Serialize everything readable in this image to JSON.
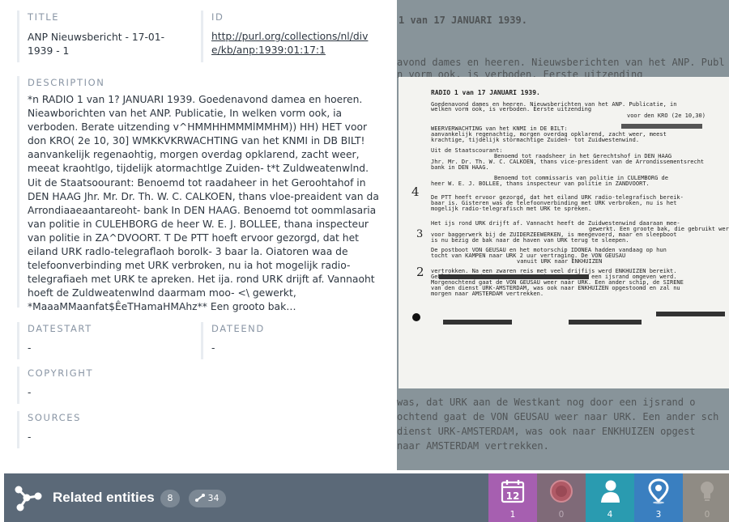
{
  "metadata": {
    "title_label": "TITLE",
    "title_value": "ANP Nieuwsbericht - 17-01-1939 - 1",
    "id_label": "ID",
    "id_value": "http://purl.org/collections/nl/dive/kb/anp:1939:01:17:1",
    "description_label": "DESCRIPTION",
    "description_value": "*n RADIO 1 van 1? JANUARI 1939. Goedenavond damea en hoeren. Nieawborichten van het ANP. Publicatie, In welken vorm ook, ia verboden. Berate uitzending v^HMMHHMMMlMMHM)) HH) HET voor don KRO( 2e 10, 30] WMKKVKRWACHTING van het KNMI in DB BILT! aanvankelijk regenaohtig, morgen overdag opklarend, zacht weer, meeat kraohtlgo, tijdelijk atormachtlge Zuiden- t*t Zuldweatenwlnd. Uit de Staatsoourant: Benoemd tot raadaheer in het Geroohtahof in DEN HAAG Jhr. Mr. Dr. Th. W. C. CALKOEN, thans vloe-preaident van da Arrondiaaeaantareoht- bank In DEN HAAG. Benoemd tot oommlasaria van politie in CULEHBORG de heer W. E. J. BOLLEE, thana inspecteur van politie in ZA^DVOORT. T De PTT hoeft ervoor gezorgd, dat het eiland URK radlo-telegraflaoh borolk- 3 baar la. Oiatoren waa de telefoonverbinding met URK verbroken, nu ia hot mogelijk radio-telegrafiaeh met URK te apreken. Het ija. rond URK drijft af. Vannaoht hoeft de Zuldweatenwlnd daarmam moo- <\\ gewerkt, *MaaaMMaanfat$ÊeTHamaHMAhz** Een grooto bak…",
    "datestart_label": "DATESTART",
    "datestart_value": "-",
    "dateend_label": "DATEEND",
    "dateend_value": "-",
    "copyright_label": "COPYRIGHT",
    "copyright_value": "-",
    "sources_label": "SOURCES",
    "sources_value": "-"
  },
  "scan": {
    "top_line": "1 van 17 JANUARI 1939.",
    "header_line": "RADIO 1 van 17 JANUARI 1939.",
    "lines": [
      "Goedenavond dames en heeren. Nieuwsberichten van het ANP. Publicatie, in",
      "welken vorm ook, is verboden. Eerste uitzending",
      "voor den KRO (2e 10,30)",
      "WEERVERWACHTING van het KNMI in DE BILT:",
      "aanvankelijk regenachtig, morgen overdag opklarend, zacht weer, meest",
      "krachtige, tijdelijk stormachtige Zuiden- tot Zuidwestenwind.",
      "Uit de Staatscourant:",
      "Benoemd tot raadsheer in het Gerechtshof in DEN HAAG",
      "Jhr. Mr. Dr. Th. W. C. CALKOEN, thans vice-president van de Arrondissementsrecht",
      "bank in DEN HAAG.",
      "Benoemd tot commissaris van politie in CULEMBORG de",
      "heer W. E. J. BOLLEE, thans inspecteur van politie in ZANDVOORT.",
      "De PTT heeft ervoor gezorgd, dat het eiland URK radio-telegrafisch bereik-",
      "baar is. Gisteren was de telefoonverbinding met URK verbroken, nu is het",
      "mogelijk radio-telegrafisch met URK te spreken.",
      "Het ijs rond URK drijft af. Vannacht heeft de Zuidwestenwind daaraan mee-",
      "gewerkt. Een groote bak, die gebruikt werd",
      "voor baggerwerk bij de ZUIDERZEEWERKEN, is meegevoerd, maar en sleepboot",
      "is nu bezig de bak naar de haven van URK terug te sleepen.",
      "De postboot VON GEUSAU en het motorschip IDONEA hadden vandaag op hun",
      "tocht van KAMPEN naar URK 2 uur vertraging. De VON GEUSAU",
      "vanuit URK naar ENKHUIZEN",
      "vertrokken. Na een zwaren reis met veel drijfijs werd ENKHUIZEN bereikt.",
      "Gebleken was, dat URK aan de Westkant nog door een ijsrand omgeven werd.",
      "Morgenochtend gaat de VON GEUSAU weer naar URK. Een ander schip, de SIRENE",
      "van den dienst URK-AMSTERDAM, was ook naar ENKHUIZEN opgestoomd en zal nu",
      "morgen naar AMSTERDAM vertrekken."
    ],
    "below_lines": [
      "was, dat URK aan de Westkant nog door een ijsrand o",
      "ochtend gaat de VON GEUSAU weer naar URK. Een ander sch",
      "dienst URK-AMSTERDAM, was ook naar ENKHUIZEN opgest",
      "naar AMSTERDAM vertrekken."
    ],
    "above_lines": [
      "avond dames en heeren. Nieuwsberichten van het ANP. Publ",
      "n vorm ook, is verboden. Eerste uitzending"
    ],
    "margin_marks": [
      "4",
      "3",
      "2"
    ]
  },
  "related": {
    "title": "Related entities",
    "count": "8",
    "links": "34",
    "tiles": [
      {
        "name": "calendar",
        "count": "1",
        "color": "#a65fb0",
        "icon": "calendar-icon"
      },
      {
        "name": "event",
        "count": "0",
        "color": "#a0626a",
        "icon": "record-icon"
      },
      {
        "name": "person",
        "count": "4",
        "color": "#2a9bb0",
        "icon": "person-icon"
      },
      {
        "name": "place",
        "count": "3",
        "color": "#3a7fc0",
        "icon": "map-pin-icon"
      },
      {
        "name": "concept",
        "count": "0",
        "color": "#9a9286",
        "icon": "lightbulb-icon"
      }
    ]
  }
}
